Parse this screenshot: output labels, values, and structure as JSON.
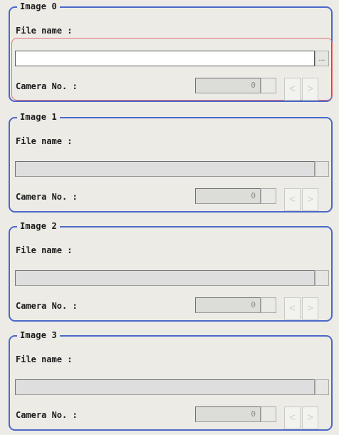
{
  "images": [
    {
      "title": "Image 0",
      "file_label": "File name :",
      "file_value": "",
      "browse_label": "...",
      "camera_label": "Camera No. :",
      "camera_value": "0",
      "prev_label": "<",
      "next_label": ">",
      "active": true
    },
    {
      "title": "Image 1",
      "file_label": "File name :",
      "file_value": "",
      "browse_label": "",
      "camera_label": "Camera No. :",
      "camera_value": "0",
      "prev_label": "<",
      "next_label": ">",
      "active": false
    },
    {
      "title": "Image 2",
      "file_label": "File name :",
      "file_value": "",
      "browse_label": "",
      "camera_label": "Camera No. :",
      "camera_value": "0",
      "prev_label": "<",
      "next_label": ">",
      "active": false
    },
    {
      "title": "Image 3",
      "file_label": "File name :",
      "file_value": "",
      "browse_label": "",
      "camera_label": "Camera No. :",
      "camera_value": "0",
      "prev_label": "<",
      "next_label": ">",
      "active": false
    }
  ],
  "colors": {
    "background": "#ecebe6",
    "group_border": "#4b68c9",
    "focus_ring": "#e2707a"
  }
}
